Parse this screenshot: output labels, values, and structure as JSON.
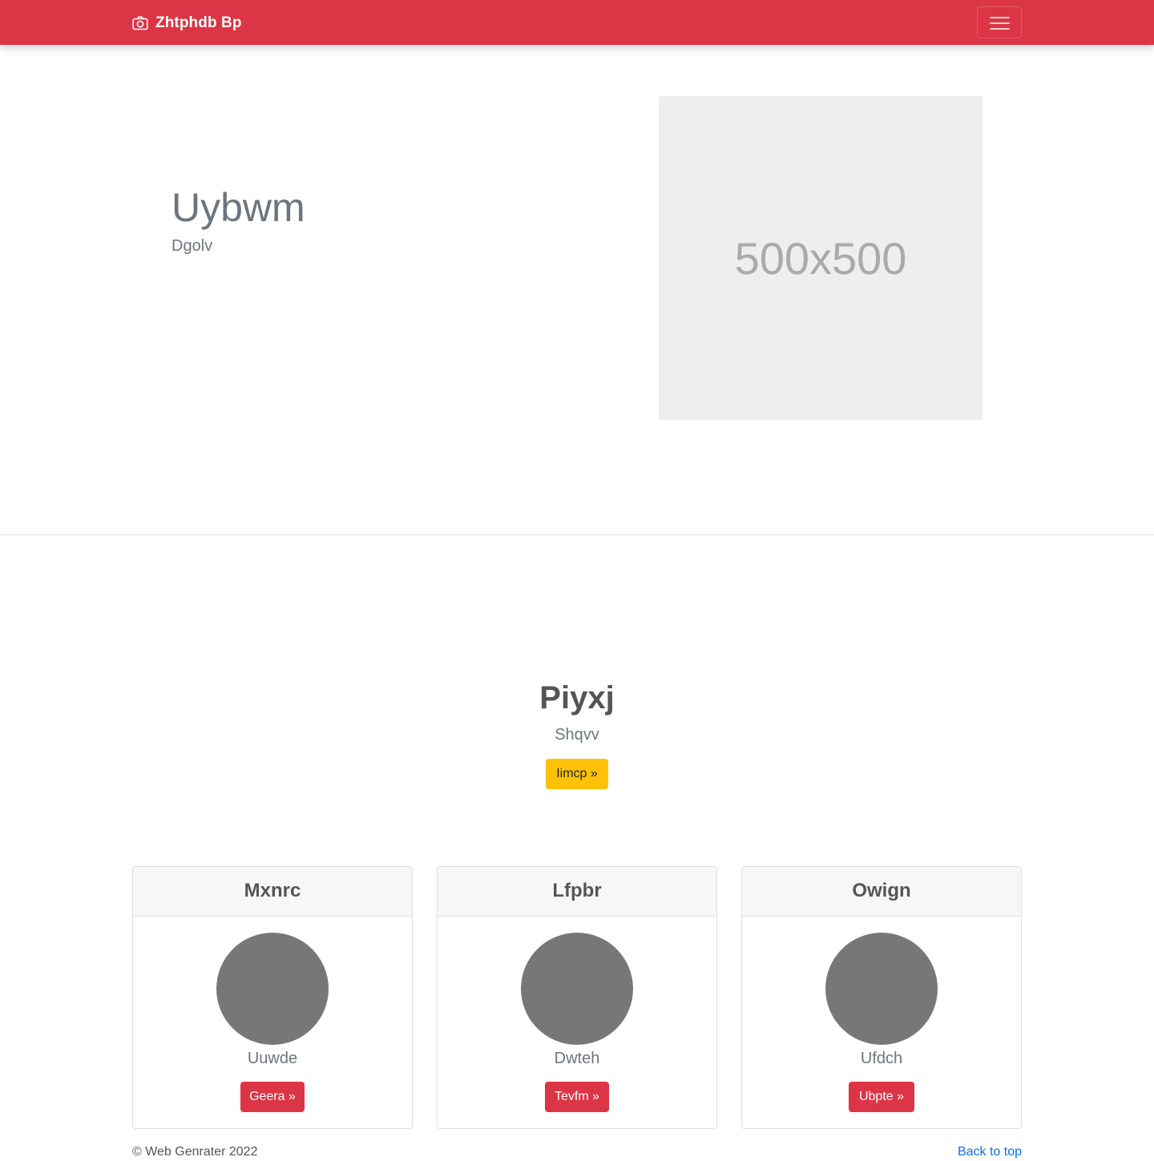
{
  "navbar": {
    "brand": "Zhtphdb Bp",
    "brand_icon": "camera-icon",
    "toggle_icon": "hamburger-icon",
    "background_color": "#dc3545"
  },
  "hero": {
    "title": "Uybwm",
    "subtitle": "Dgolv",
    "image_placeholder": "500x500"
  },
  "intro": {
    "title": "Piyxj",
    "subtitle": "Shqvv",
    "button_label": "Iimcp »",
    "button_color": "#ffc107"
  },
  "cards": [
    {
      "title": "Mxnrc",
      "text": "Uuwde",
      "button_label": "Geera »"
    },
    {
      "title": "Lfpbr",
      "text": "Dwteh",
      "button_label": "Tevfm »"
    },
    {
      "title": "Owign",
      "text": "Ufdch",
      "button_label": "Ubpte »"
    }
  ],
  "footer": {
    "copyright": "© Web Genrater 2022",
    "back_to_top": "Back to top",
    "link_color": "#0d6efd"
  }
}
